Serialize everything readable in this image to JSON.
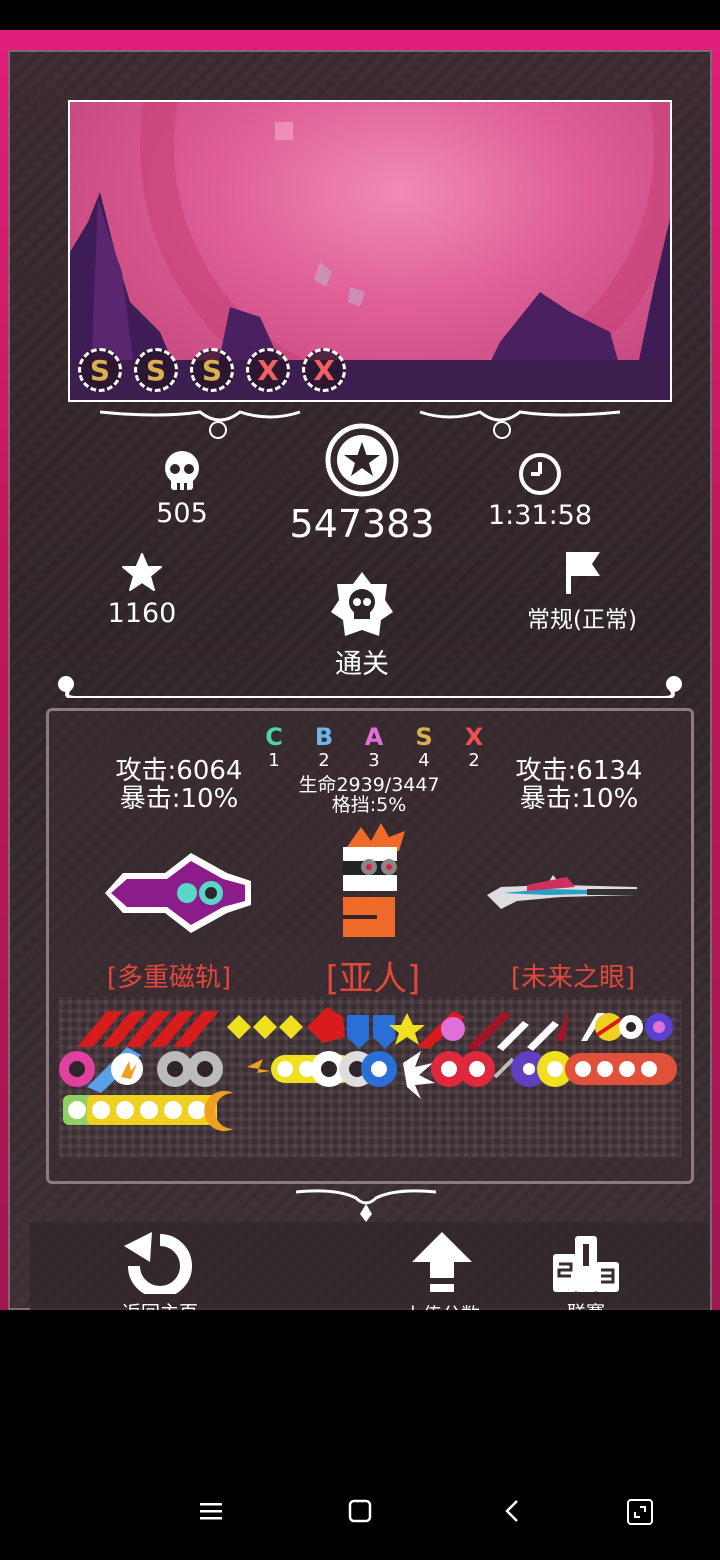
{
  "preview": {
    "ranks": [
      "S",
      "S",
      "S",
      "X",
      "X"
    ]
  },
  "stats": {
    "kills": "505",
    "score": "547383",
    "time": "1:31:58",
    "stars": "1160",
    "difficulty": "常规(正常)",
    "result": "通关"
  },
  "grades": [
    {
      "letter": "C",
      "count": "1",
      "color": "#4fd6a0"
    },
    {
      "letter": "B",
      "count": "2",
      "color": "#6cb6e8"
    },
    {
      "letter": "A",
      "count": "3",
      "color": "#e070d8"
    },
    {
      "letter": "S",
      "count": "4",
      "color": "#d9b050"
    },
    {
      "letter": "X",
      "count": "2",
      "color": "#f05050"
    }
  ],
  "left_weapon": {
    "attack": "攻击:6064",
    "crit": "暴击:10%",
    "name": "[多重磁轨]"
  },
  "character": {
    "hp": "生命2939/3447",
    "block": "格挡:5%",
    "name": "[亚人]"
  },
  "right_weapon": {
    "attack": "攻击:6134",
    "crit": "暴击:10%",
    "name": "[未来之眼]"
  },
  "nav": {
    "home": "返回主页",
    "upload": "上传分数",
    "league": "联赛"
  },
  "colors": {
    "accent": "#e01f7c",
    "panel": "#2f2428",
    "name_red": "#e0483c"
  }
}
